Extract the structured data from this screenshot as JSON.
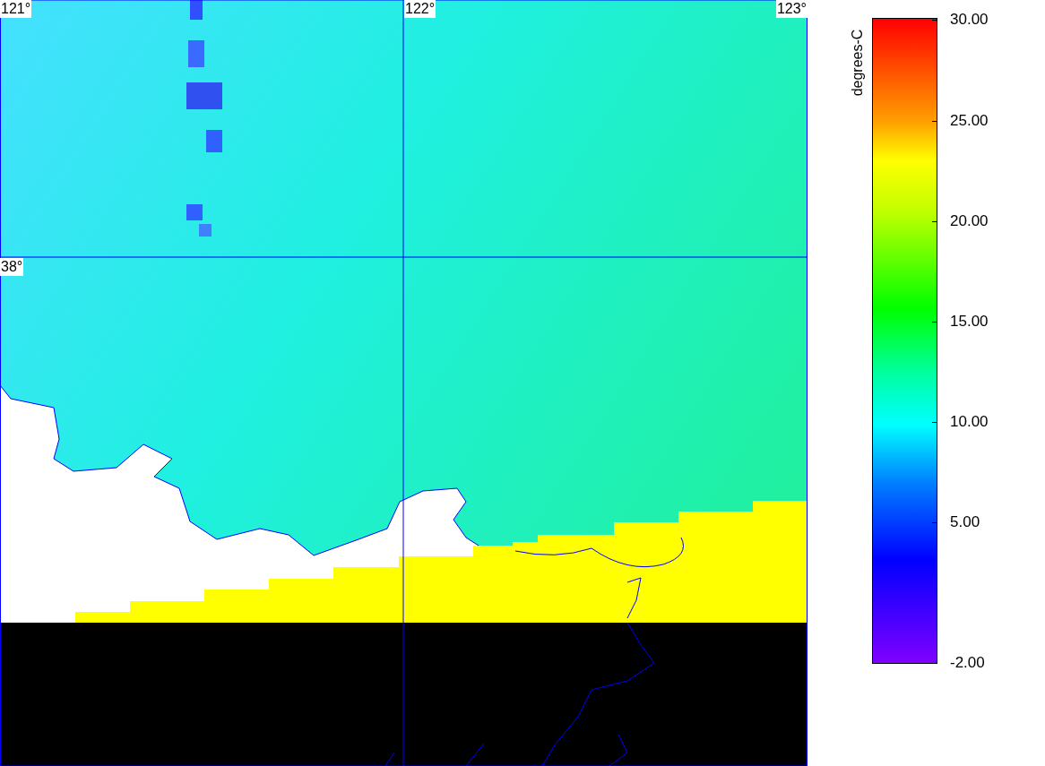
{
  "map": {
    "longitude_labels": [
      "121°",
      "122°",
      "123°"
    ],
    "latitude_labels": [
      "38°"
    ]
  },
  "colorbar": {
    "title": "degrees-C",
    "ticks": [
      "30.00",
      "25.00",
      "20.00",
      "15.00",
      "10.00",
      "5.00",
      "-2.00"
    ]
  }
}
